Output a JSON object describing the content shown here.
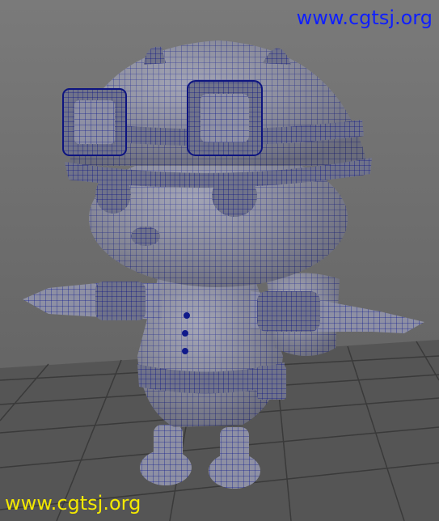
{
  "watermarks": {
    "top": {
      "text": "www.cgtsj.org",
      "color": "#1020ff"
    },
    "bottom": {
      "text": "www.cgtsj.org",
      "color": "#f2e600"
    }
  },
  "viewport": {
    "background": "#6b6b6b",
    "grid_color": "#3a3a3a",
    "wireframe_color": "#101a8a",
    "model_color": "#8d8fa2"
  }
}
